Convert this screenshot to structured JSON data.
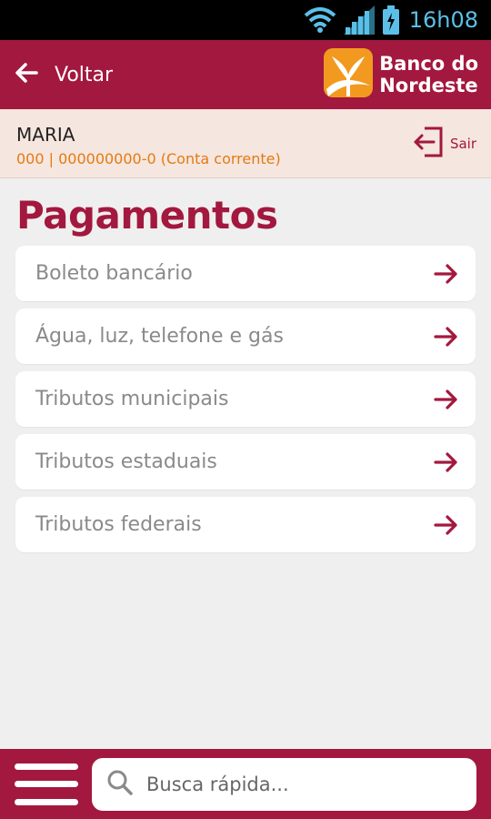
{
  "status_bar": {
    "time": "16h08"
  },
  "header": {
    "back_label": "Voltar",
    "brand_line1": "Banco do",
    "brand_line2": "Nordeste"
  },
  "user": {
    "name": "MARIA",
    "account": "000 | 000000000-0 (Conta corrente)",
    "logout_label": "Sair"
  },
  "page": {
    "title": "Pagamentos"
  },
  "menu": {
    "items": [
      {
        "label": "Boleto bancário"
      },
      {
        "label": "Água, luz, telefone e gás"
      },
      {
        "label": "Tributos municipais"
      },
      {
        "label": "Tributos estaduais"
      },
      {
        "label": "Tributos federais"
      }
    ]
  },
  "search": {
    "placeholder": "Busca rápida..."
  },
  "colors": {
    "brand": "#a3183e",
    "accent_orange": "#e57a12",
    "user_strip_bg": "#f5e6df",
    "page_bg": "#efefef",
    "status_icon": "#5bc0e8"
  },
  "icons": [
    "wifi-icon",
    "signal-icon",
    "battery-icon",
    "back-arrow-icon",
    "bank-logo-icon",
    "logout-icon",
    "arrow-right-icon",
    "hamburger-menu-icon",
    "search-icon"
  ]
}
